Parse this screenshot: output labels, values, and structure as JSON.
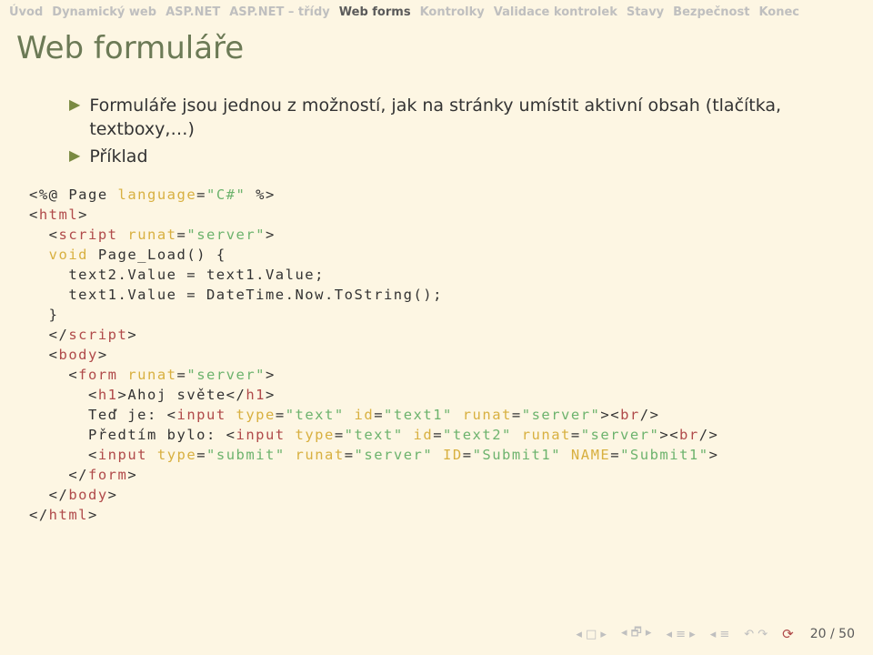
{
  "nav": {
    "items": [
      "Úvod",
      "Dynamický web",
      "ASP.NET",
      "ASP.NET – třídy",
      "Web forms",
      "Kontrolky",
      "Validace kontrolek",
      "Stavy",
      "Bezpečnost",
      "Konec"
    ],
    "active_index": 4
  },
  "title": "Web formuláře",
  "bullets": [
    "Formuláře jsou jednou z možností, jak na stránky umístit aktivní obsah (tlačítka, textboxy,…)",
    "Příklad"
  ],
  "code": {
    "l01a": "<%@ Page ",
    "l01b": "language",
    "l01c": "=",
    "l01d": "\"C#\"",
    "l01e": " %>",
    "l02a": "<",
    "l02b": "html",
    "l02c": ">",
    "l03pad": "  ",
    "l03a": "<",
    "l03b": "script",
    "l03c": " ",
    "l03d": "runat",
    "l03e": "=",
    "l03f": "\"server\"",
    "l03g": ">",
    "l04pad": "  ",
    "l04a": "void",
    "l04b": " Page_Load() {",
    "l05pad": "    ",
    "l05": "text2.Value = text1.Value;",
    "l06pad": "    ",
    "l06": "text1.Value = DateTime.Now.ToString();",
    "l07pad": "  ",
    "l07": "}",
    "l08pad": "  ",
    "l08a": "</",
    "l08b": "script",
    "l08c": ">",
    "l09pad": "  ",
    "l09a": "<",
    "l09b": "body",
    "l09c": ">",
    "l10pad": "    ",
    "l10a": "<",
    "l10b": "form",
    "l10c": " ",
    "l10d": "runat",
    "l10e": "=",
    "l10f": "\"server\"",
    "l10g": ">",
    "l11pad": "      ",
    "l11a": "<",
    "l11b": "h1",
    "l11c": ">Ahoj světe</",
    "l11d": "h1",
    "l11e": ">",
    "l12pad": "      ",
    "l12a": "Teď je: <",
    "l12b": "input",
    "l12c": " ",
    "l12d": "type",
    "l12e": "=",
    "l12f": "\"text\"",
    "l12g": " ",
    "l12h": "id",
    "l12i": "=",
    "l12j": "\"text1\"",
    "l12k": " ",
    "l12l": "runat",
    "l12m": "=",
    "l12n": "\"server\"",
    "l12o": "><",
    "l12p": "br",
    "l12q": "/>",
    "l13pad": "      ",
    "l13a": "Předtím bylo: <",
    "l13b": "input",
    "l13c": " ",
    "l13d": "type",
    "l13e": "=",
    "l13f": "\"text\"",
    "l13g": " ",
    "l13h": "id",
    "l13i": "=",
    "l13j": "\"text2\"",
    "l13k": " ",
    "l13l": "runat",
    "l13m": "=",
    "l13n": "\"server\"",
    "l13o": "><",
    "l13p": "br",
    "l13q": "/>",
    "l14pad": "      ",
    "l14a": "<",
    "l14b": "input",
    "l14c": " ",
    "l14d": "type",
    "l14e": "=",
    "l14f": "\"submit\"",
    "l14g": " ",
    "l14h": "runat",
    "l14i": "=",
    "l14j": "\"server\"",
    "l14k": " ",
    "l14l": "ID",
    "l14m": "=",
    "l14n": "\"Submit1\"",
    "l14o": " ",
    "l14p": "NAME",
    "l14q": "=",
    "l14r": "\"Submit1\"",
    "l14s": ">",
    "l15pad": "    ",
    "l15a": "</",
    "l15b": "form",
    "l15c": ">",
    "l16pad": "  ",
    "l16a": "</",
    "l16b": "body",
    "l16c": ">",
    "l17a": "</",
    "l17b": "html",
    "l17c": ">"
  },
  "footer": {
    "page": "20 / 50"
  }
}
